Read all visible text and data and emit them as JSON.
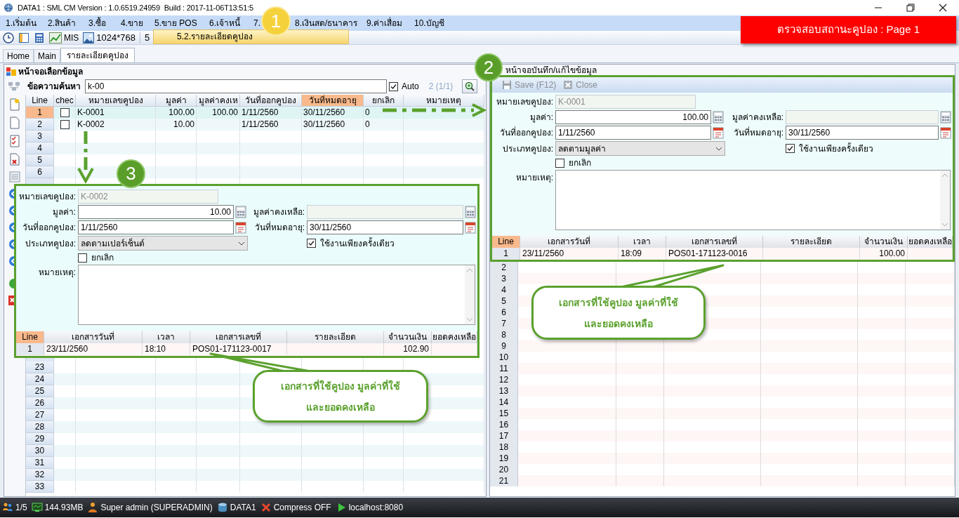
{
  "window": {
    "title": "DATA1 : SML CM Version : 1.0.6519.24959  Build : 2017-11-06T13:51:5"
  },
  "menu": [
    "1.เริ่มต้น",
    "2.สินค้า",
    "3.ซื้อ",
    "4.ขาย",
    "5.ขาย POS",
    "6.เจ้าหนี้",
    "7.",
    "8.เงินสด/ธนาคาร",
    "9.ค่าเสื่อม",
    "10.บัญชี"
  ],
  "toolbar": [
    "MIS",
    "1024*768",
    "5"
  ],
  "menu_popup": {
    "label": "5.2.รายละเอียดคูปอง"
  },
  "banner": "ตรวจสอบสถานะคูปอง : Page 1",
  "tabs": [
    {
      "label": "Home",
      "selected": false
    },
    {
      "label": "Main",
      "selected": false
    },
    {
      "label": "รายละเอียดคูปอง",
      "selected": true
    }
  ],
  "left_panel": {
    "title": "หน้าจอเลือกข้อมูล",
    "search": {
      "label": "ข้อความค้นหา",
      "value": "k-00",
      "auto": {
        "label": "Auto",
        "checked": true
      },
      "count": "2 (1/1)"
    },
    "grid": {
      "columns": [
        {
          "label": "Line",
          "highlighted": false
        },
        {
          "label": "chec",
          "highlighted": false
        },
        {
          "label": "หมายเลขคูปอง",
          "highlighted": false
        },
        {
          "label": "มูลค่า",
          "highlighted": false
        },
        {
          "label": "มูลค่าคงเห",
          "highlighted": false
        },
        {
          "label": "วันที่ออกคูปอง",
          "highlighted": false
        },
        {
          "label": "วันที่หมดอายุ",
          "highlighted": true
        },
        {
          "label": "ยกเลิก",
          "highlighted": false
        },
        {
          "label": "หมายเหตุ",
          "highlighted": false
        }
      ],
      "rows": [
        {
          "line": "1",
          "selected": true,
          "checked": false,
          "cells": {
            "coupon_no": "K-0001",
            "value": "100.00",
            "remaining": "100.00",
            "issued": "1/11/2560",
            "expires": "30/11/2560",
            "cancelled": "0"
          }
        },
        {
          "line": "2",
          "selected": false,
          "checked": false,
          "cells": {
            "coupon_no": "K-0002",
            "value": "10.00",
            "issued": "1/11/2560",
            "expires": "30/11/2560",
            "cancelled": "0"
          }
        },
        {
          "line": "3",
          "selected": false
        },
        {
          "line": "4",
          "selected": false
        },
        {
          "line": "5",
          "selected": false
        },
        {
          "line": "6",
          "selected": false
        }
      ],
      "rows_below": [
        {
          "line": "23",
          "selected": false
        },
        {
          "line": "24",
          "selected": false
        },
        {
          "line": "25",
          "selected": false
        },
        {
          "line": "26",
          "selected": false
        },
        {
          "line": "27",
          "selected": false
        },
        {
          "line": "28",
          "selected": false
        },
        {
          "line": "29",
          "selected": false
        },
        {
          "line": "30",
          "selected": false
        },
        {
          "line": "31",
          "selected": false
        },
        {
          "line": "32",
          "selected": false
        },
        {
          "line": "33",
          "selected": false
        }
      ]
    }
  },
  "editor": {
    "title": "หน้าจอบันทึก/แก้ไขข้อมูล",
    "buttons": [
      {
        "label": "Save (F12)",
        "kind": "save",
        "disabled": true
      },
      {
        "label": "Close",
        "kind": "close",
        "disabled": true
      }
    ],
    "form": {
      "coupon_no": {
        "label": "หมายเลขคูปอง:",
        "value": "K-0001",
        "disabled": true
      },
      "value": {
        "label": "มูลค่า:",
        "value": "100.00",
        "disabled": false
      },
      "remaining": {
        "label": "มูลค่าคงเหลือ:",
        "disabled": true
      },
      "issue_date": {
        "label": "วันที่ออกคูปอง:",
        "value": "1/11/2560"
      },
      "expiry_date": {
        "label": "วันที่หมดอายุ:",
        "value": "30/11/2560"
      },
      "type": {
        "label": "ประเภทคูปอง:",
        "value": "ลดตามมูลค่า"
      },
      "single_use": {
        "label": "ใช้งานเพียงครั้งเดียว",
        "checked": true
      },
      "cancelled": {
        "label": "ยกเลิก",
        "checked": false
      },
      "note": {
        "label": "หมายเหตุ:"
      }
    },
    "usage": {
      "columns": [
        {
          "label": "Line",
          "highlighted": true
        },
        {
          "label": "เอกสารวันที่",
          "highlighted": false
        },
        {
          "label": "เวลา",
          "highlighted": false
        },
        {
          "label": "เอกสารเลขที่",
          "highlighted": false
        },
        {
          "label": "รายละเอียด",
          "highlighted": false
        },
        {
          "label": "จำนวนเงิน",
          "highlighted": false
        },
        {
          "label": "ยอดคงเหลือ",
          "highlighted": false
        }
      ],
      "rows": [
        {
          "line": "1",
          "cells": {
            "date": "23/11/2560",
            "time": "18:09",
            "doc_no": "POS01-171123-0016",
            "amount": "100.00"
          }
        }
      ]
    },
    "rows_below": [
      "2",
      "3",
      "4",
      "5",
      "6",
      "7",
      "8",
      "9",
      "10",
      "11",
      "12",
      "13",
      "14",
      "15",
      "16",
      "17",
      "18",
      "19",
      "20",
      "21"
    ]
  },
  "detail_popup": {
    "form": {
      "coupon_no": {
        "label": "หมายเลขคูปอง:",
        "value": "K-0002",
        "disabled": true
      },
      "value": {
        "label": "มูลค่า:",
        "value": "10.00",
        "disabled": false
      },
      "remaining": {
        "label": "มูลค่าคงเหลือ:",
        "disabled": true
      },
      "issue_date": {
        "label": "วันที่ออกคูปอง:",
        "value": "1/11/2560"
      },
      "expiry_date": {
        "label": "วันที่หมดอายุ:",
        "value": "30/11/2560"
      },
      "type": {
        "label": "ประเภทคูปอง:",
        "value": "ลดตามเปอร์เซ็นต์"
      },
      "single_use": {
        "label": "ใช้งานเพียงครั้งเดียว",
        "checked": true
      },
      "cancelled": {
        "label": "ยกเลิก",
        "checked": false
      },
      "note": {
        "label": "หมายเหตุ:"
      }
    },
    "usage": {
      "columns": [
        {
          "label": "Line",
          "highlighted": true
        },
        {
          "label": "เอกสารวันที่",
          "highlighted": false
        },
        {
          "label": "เวลา",
          "highlighted": false
        },
        {
          "label": "เอกสารเลขที่",
          "highlighted": false
        },
        {
          "label": "รายละเอียด",
          "highlighted": false
        },
        {
          "label": "จำนวนเงิน",
          "highlighted": false
        },
        {
          "label": "ยอดคงเหลือ",
          "highlighted": false
        }
      ],
      "rows": [
        {
          "line": "1",
          "cells": {
            "date": "23/11/2560",
            "time": "18:10",
            "doc_no": "POS01-171123-0017",
            "amount": "102.90"
          }
        }
      ]
    }
  },
  "badges": [
    "1",
    "2",
    "3"
  ],
  "callouts": [
    {
      "text": "เอกสารที่ใช้คูปอง มูลค่าที่ใช้\nและยอดคงเหลือ"
    },
    {
      "text": "เอกสารที่ใช้คูปอง มูลค่าที่ใช้\nและยอดคงเหลือ"
    }
  ],
  "status_bar": [
    {
      "kind": "sessions",
      "text": "1/5"
    },
    {
      "kind": "memory",
      "text": "144.93MB"
    },
    {
      "kind": "user",
      "text": "Super admin (SUPERADMIN)"
    },
    {
      "kind": "database",
      "text": "DATA1"
    },
    {
      "kind": "compress",
      "text": "Compress OFF"
    },
    {
      "kind": "server",
      "text": "localhost:8080"
    }
  ]
}
